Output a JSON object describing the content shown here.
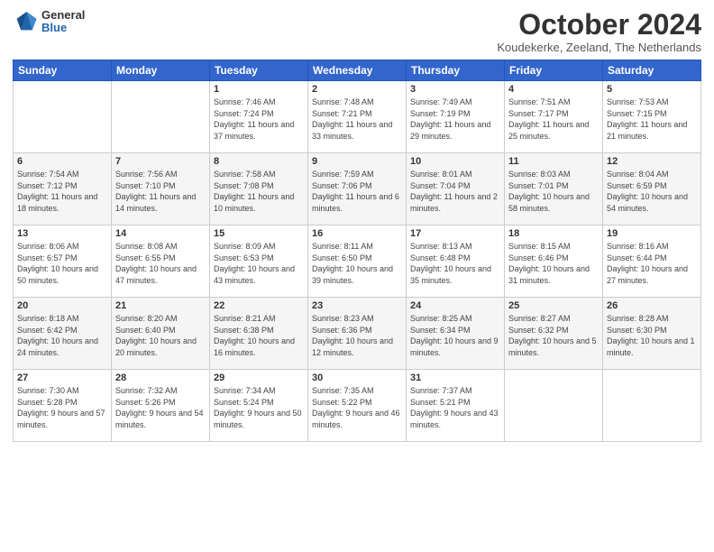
{
  "logo": {
    "general": "General",
    "blue": "Blue"
  },
  "header": {
    "month": "October 2024",
    "location": "Koudekerke, Zeeland, The Netherlands"
  },
  "weekdays": [
    "Sunday",
    "Monday",
    "Tuesday",
    "Wednesday",
    "Thursday",
    "Friday",
    "Saturday"
  ],
  "weeks": [
    [
      {
        "day": "",
        "sunrise": "",
        "sunset": "",
        "daylight": ""
      },
      {
        "day": "",
        "sunrise": "",
        "sunset": "",
        "daylight": ""
      },
      {
        "day": "1",
        "sunrise": "Sunrise: 7:46 AM",
        "sunset": "Sunset: 7:24 PM",
        "daylight": "Daylight: 11 hours and 37 minutes."
      },
      {
        "day": "2",
        "sunrise": "Sunrise: 7:48 AM",
        "sunset": "Sunset: 7:21 PM",
        "daylight": "Daylight: 11 hours and 33 minutes."
      },
      {
        "day": "3",
        "sunrise": "Sunrise: 7:49 AM",
        "sunset": "Sunset: 7:19 PM",
        "daylight": "Daylight: 11 hours and 29 minutes."
      },
      {
        "day": "4",
        "sunrise": "Sunrise: 7:51 AM",
        "sunset": "Sunset: 7:17 PM",
        "daylight": "Daylight: 11 hours and 25 minutes."
      },
      {
        "day": "5",
        "sunrise": "Sunrise: 7:53 AM",
        "sunset": "Sunset: 7:15 PM",
        "daylight": "Daylight: 11 hours and 21 minutes."
      }
    ],
    [
      {
        "day": "6",
        "sunrise": "Sunrise: 7:54 AM",
        "sunset": "Sunset: 7:12 PM",
        "daylight": "Daylight: 11 hours and 18 minutes."
      },
      {
        "day": "7",
        "sunrise": "Sunrise: 7:56 AM",
        "sunset": "Sunset: 7:10 PM",
        "daylight": "Daylight: 11 hours and 14 minutes."
      },
      {
        "day": "8",
        "sunrise": "Sunrise: 7:58 AM",
        "sunset": "Sunset: 7:08 PM",
        "daylight": "Daylight: 11 hours and 10 minutes."
      },
      {
        "day": "9",
        "sunrise": "Sunrise: 7:59 AM",
        "sunset": "Sunset: 7:06 PM",
        "daylight": "Daylight: 11 hours and 6 minutes."
      },
      {
        "day": "10",
        "sunrise": "Sunrise: 8:01 AM",
        "sunset": "Sunset: 7:04 PM",
        "daylight": "Daylight: 11 hours and 2 minutes."
      },
      {
        "day": "11",
        "sunrise": "Sunrise: 8:03 AM",
        "sunset": "Sunset: 7:01 PM",
        "daylight": "Daylight: 10 hours and 58 minutes."
      },
      {
        "day": "12",
        "sunrise": "Sunrise: 8:04 AM",
        "sunset": "Sunset: 6:59 PM",
        "daylight": "Daylight: 10 hours and 54 minutes."
      }
    ],
    [
      {
        "day": "13",
        "sunrise": "Sunrise: 8:06 AM",
        "sunset": "Sunset: 6:57 PM",
        "daylight": "Daylight: 10 hours and 50 minutes."
      },
      {
        "day": "14",
        "sunrise": "Sunrise: 8:08 AM",
        "sunset": "Sunset: 6:55 PM",
        "daylight": "Daylight: 10 hours and 47 minutes."
      },
      {
        "day": "15",
        "sunrise": "Sunrise: 8:09 AM",
        "sunset": "Sunset: 6:53 PM",
        "daylight": "Daylight: 10 hours and 43 minutes."
      },
      {
        "day": "16",
        "sunrise": "Sunrise: 8:11 AM",
        "sunset": "Sunset: 6:50 PM",
        "daylight": "Daylight: 10 hours and 39 minutes."
      },
      {
        "day": "17",
        "sunrise": "Sunrise: 8:13 AM",
        "sunset": "Sunset: 6:48 PM",
        "daylight": "Daylight: 10 hours and 35 minutes."
      },
      {
        "day": "18",
        "sunrise": "Sunrise: 8:15 AM",
        "sunset": "Sunset: 6:46 PM",
        "daylight": "Daylight: 10 hours and 31 minutes."
      },
      {
        "day": "19",
        "sunrise": "Sunrise: 8:16 AM",
        "sunset": "Sunset: 6:44 PM",
        "daylight": "Daylight: 10 hours and 27 minutes."
      }
    ],
    [
      {
        "day": "20",
        "sunrise": "Sunrise: 8:18 AM",
        "sunset": "Sunset: 6:42 PM",
        "daylight": "Daylight: 10 hours and 24 minutes."
      },
      {
        "day": "21",
        "sunrise": "Sunrise: 8:20 AM",
        "sunset": "Sunset: 6:40 PM",
        "daylight": "Daylight: 10 hours and 20 minutes."
      },
      {
        "day": "22",
        "sunrise": "Sunrise: 8:21 AM",
        "sunset": "Sunset: 6:38 PM",
        "daylight": "Daylight: 10 hours and 16 minutes."
      },
      {
        "day": "23",
        "sunrise": "Sunrise: 8:23 AM",
        "sunset": "Sunset: 6:36 PM",
        "daylight": "Daylight: 10 hours and 12 minutes."
      },
      {
        "day": "24",
        "sunrise": "Sunrise: 8:25 AM",
        "sunset": "Sunset: 6:34 PM",
        "daylight": "Daylight: 10 hours and 9 minutes."
      },
      {
        "day": "25",
        "sunrise": "Sunrise: 8:27 AM",
        "sunset": "Sunset: 6:32 PM",
        "daylight": "Daylight: 10 hours and 5 minutes."
      },
      {
        "day": "26",
        "sunrise": "Sunrise: 8:28 AM",
        "sunset": "Sunset: 6:30 PM",
        "daylight": "Daylight: 10 hours and 1 minute."
      }
    ],
    [
      {
        "day": "27",
        "sunrise": "Sunrise: 7:30 AM",
        "sunset": "Sunset: 5:28 PM",
        "daylight": "Daylight: 9 hours and 57 minutes."
      },
      {
        "day": "28",
        "sunrise": "Sunrise: 7:32 AM",
        "sunset": "Sunset: 5:26 PM",
        "daylight": "Daylight: 9 hours and 54 minutes."
      },
      {
        "day": "29",
        "sunrise": "Sunrise: 7:34 AM",
        "sunset": "Sunset: 5:24 PM",
        "daylight": "Daylight: 9 hours and 50 minutes."
      },
      {
        "day": "30",
        "sunrise": "Sunrise: 7:35 AM",
        "sunset": "Sunset: 5:22 PM",
        "daylight": "Daylight: 9 hours and 46 minutes."
      },
      {
        "day": "31",
        "sunrise": "Sunrise: 7:37 AM",
        "sunset": "Sunset: 5:21 PM",
        "daylight": "Daylight: 9 hours and 43 minutes."
      },
      {
        "day": "",
        "sunrise": "",
        "sunset": "",
        "daylight": ""
      },
      {
        "day": "",
        "sunrise": "",
        "sunset": "",
        "daylight": ""
      }
    ]
  ]
}
